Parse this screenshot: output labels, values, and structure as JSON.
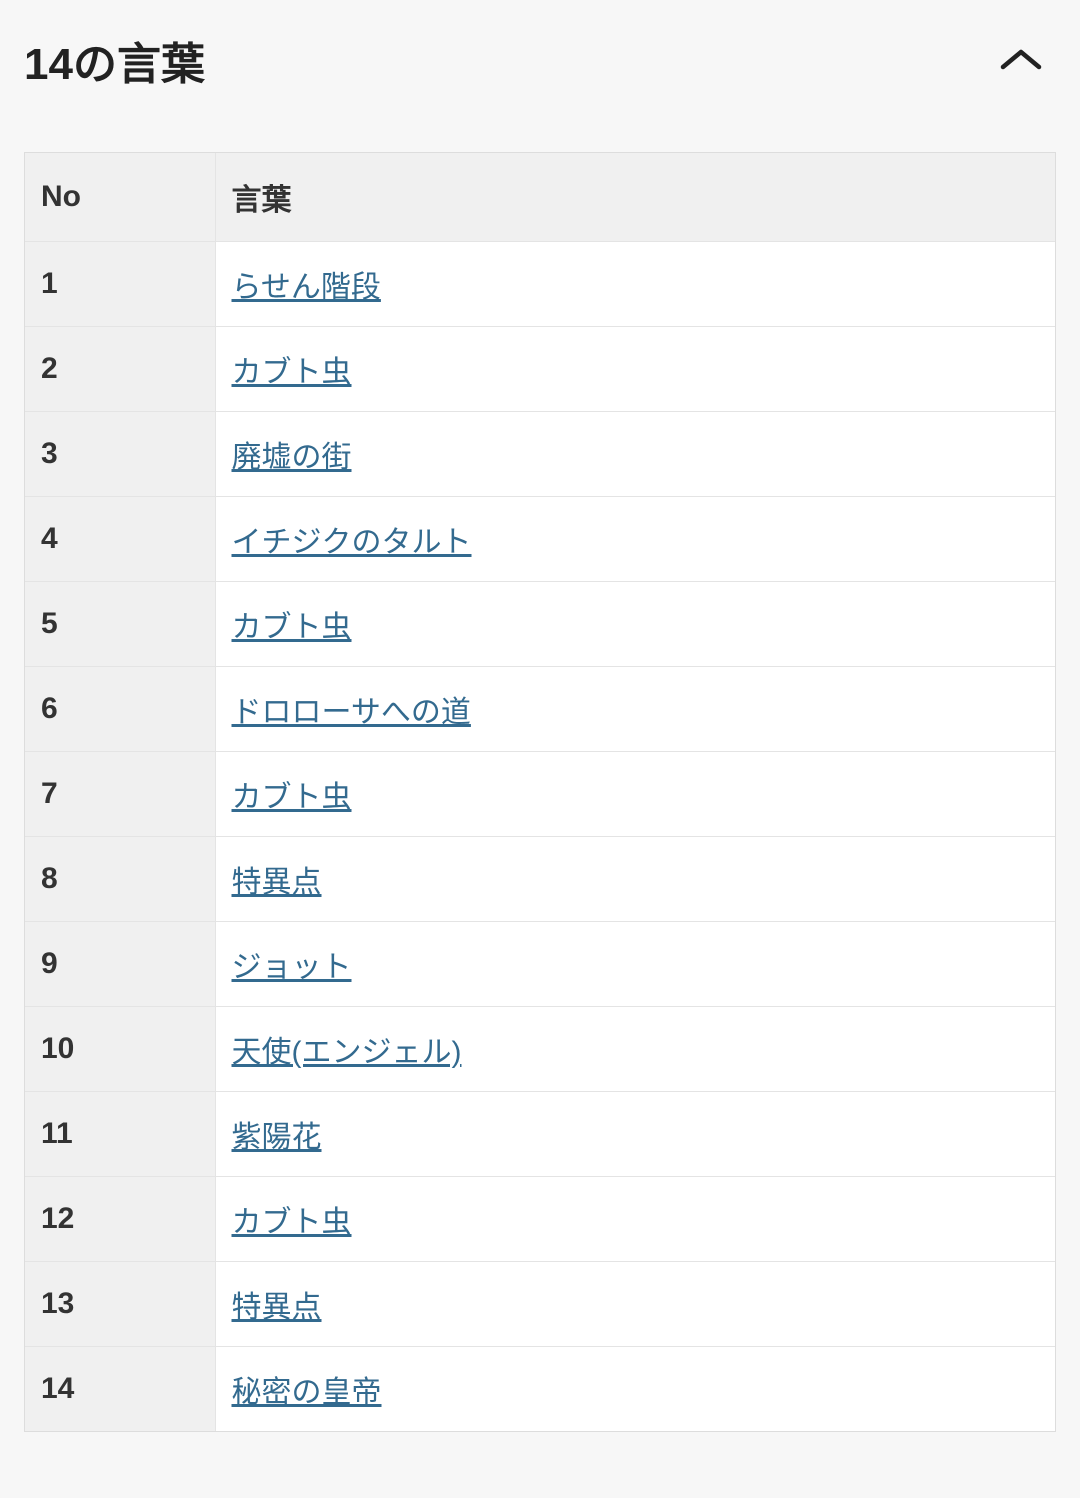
{
  "header": {
    "title": "14の言葉"
  },
  "table": {
    "columns": {
      "no": "No",
      "word": "言葉"
    },
    "rows": [
      {
        "no": "1",
        "word": "らせん階段"
      },
      {
        "no": "2",
        "word": "カブト虫"
      },
      {
        "no": "3",
        "word": "廃墟の街"
      },
      {
        "no": "4",
        "word": "イチジクのタルト"
      },
      {
        "no": "5",
        "word": "カブト虫"
      },
      {
        "no": "6",
        "word": "ドロローサへの道"
      },
      {
        "no": "7",
        "word": "カブト虫"
      },
      {
        "no": "8",
        "word": "特異点"
      },
      {
        "no": "9",
        "word": "ジョット"
      },
      {
        "no": "10",
        "word": "天使(エンジェル)"
      },
      {
        "no": "11",
        "word": "紫陽花"
      },
      {
        "no": "12",
        "word": "カブト虫"
      },
      {
        "no": "13",
        "word": "特異点"
      },
      {
        "no": "14",
        "word": "秘密の皇帝"
      }
    ]
  }
}
